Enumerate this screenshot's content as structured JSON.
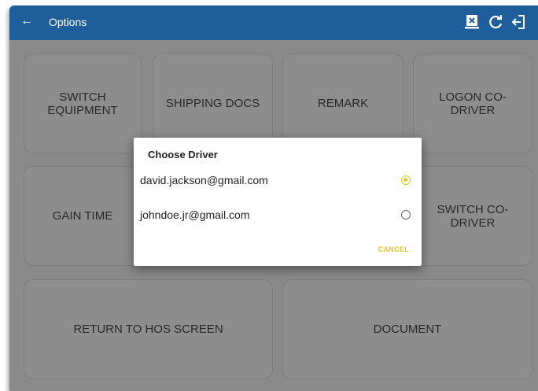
{
  "appbar": {
    "title": "Options"
  },
  "tiles": {
    "switch_equipment": "SWITCH EQUIPMENT",
    "shipping_docs": "SHIPPING DOCS",
    "remark": "REMARK",
    "logon_co_driver": "LOGON CO-DRIVER",
    "gain_time": "GAIN TIME",
    "switch_co_driver": "SWITCH CO-DRIVER",
    "return_to_hos": "RETURN TO HOS SCREEN",
    "document": "DOCUMENT"
  },
  "dialog": {
    "title": "Choose Driver",
    "options": [
      {
        "label": "david.jackson@gmail.com",
        "selected": true
      },
      {
        "label": "johndoe.jr@gmail.com",
        "selected": false
      }
    ],
    "cancel_label": "CANCEL"
  },
  "colors": {
    "appbar": "#1e5f9b",
    "accent": "#f0c21a"
  },
  "icons": [
    "back-arrow-icon",
    "print-doc-icon",
    "refresh-icon",
    "logout-icon"
  ]
}
